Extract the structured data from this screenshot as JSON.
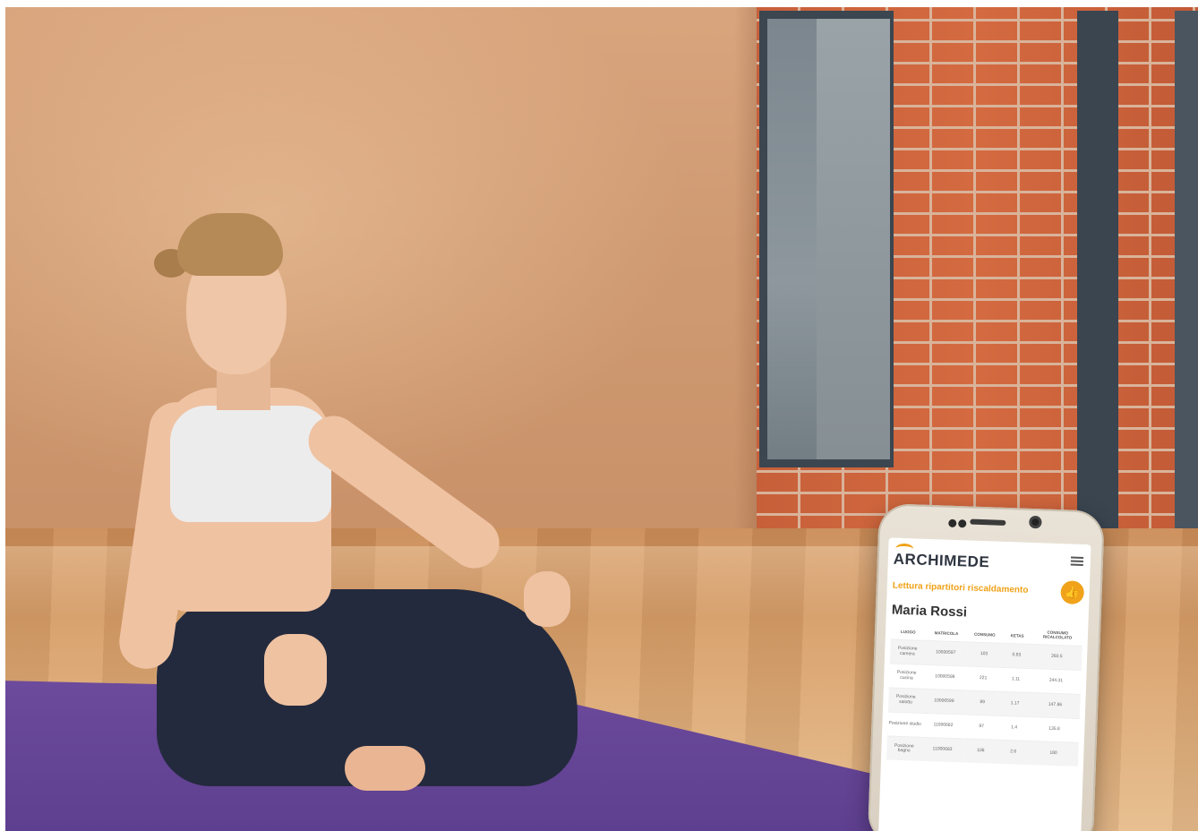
{
  "app": {
    "logo_text": "ARCHIMEDE",
    "brand_color": "#f0a21a",
    "menu_icon": "hamburger-menu-icon",
    "section_title": "Lettura ripartitori riscaldamento",
    "action_icon": "thumbs-up-icon",
    "user_name": "Maria Rossi"
  },
  "table": {
    "columns": [
      "Luogo",
      "Matricola",
      "Consumo",
      "Ketas",
      "Consumo ricalcolato"
    ],
    "rows": [
      {
        "luogo": "Posizione camera",
        "matricola": "10000597",
        "consumo": "103",
        "k": "0.83",
        "ricalcolato": "260.5"
      },
      {
        "luogo": "Posizione cucina",
        "matricola": "10000598",
        "consumo": "221",
        "k": "1.11",
        "ricalcolato": "244.31"
      },
      {
        "luogo": "Posizione salotto",
        "matricola": "10000599",
        "consumo": "89",
        "k": "1.17",
        "ricalcolato": "147.86"
      },
      {
        "luogo": "Posizione studio",
        "matricola": "11000682",
        "consumo": "97",
        "k": "1.4",
        "ricalcolato": "135.8"
      },
      {
        "luogo": "Posizione bagno",
        "matricola": "11000683",
        "consumo": "106",
        "k": "2.6",
        "ricalcolato": "180"
      }
    ]
  }
}
